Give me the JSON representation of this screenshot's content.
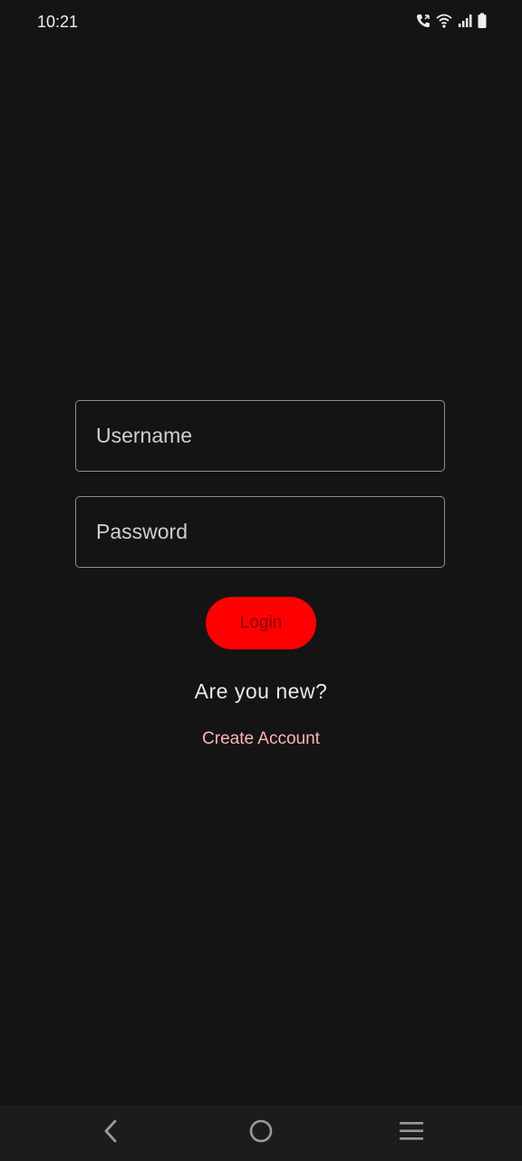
{
  "status_bar": {
    "time": "10:21",
    "icons": [
      "call-icon",
      "wifi-icon",
      "signal-icon",
      "battery-icon"
    ]
  },
  "login_form": {
    "username_placeholder": "Username",
    "password_placeholder": "Password",
    "login_label": "Login",
    "new_user_prompt": "Are you new?",
    "create_account_label": "Create Account"
  },
  "colors": {
    "background": "#141414",
    "accent": "#ff0000",
    "link": "#ffb3b8"
  },
  "navigation": {
    "buttons": [
      "back-icon",
      "home-icon",
      "recents-icon"
    ]
  }
}
